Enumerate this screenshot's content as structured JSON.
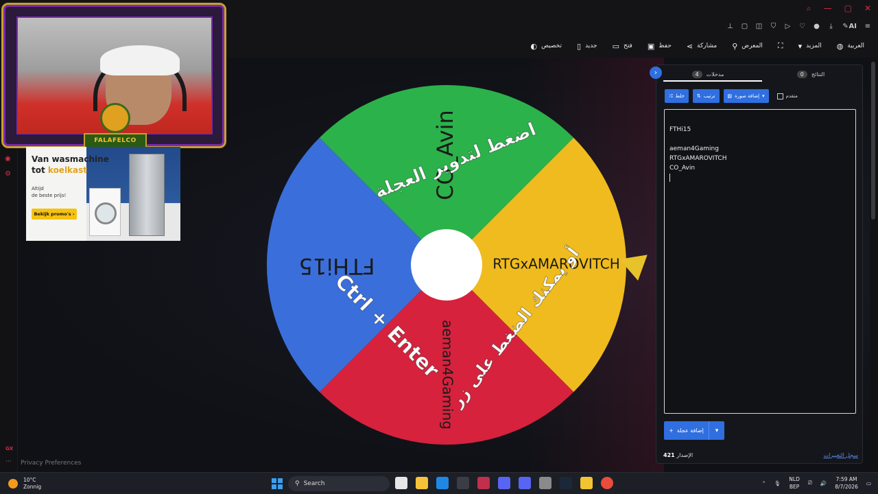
{
  "browser": {
    "window_controls": [
      "⌕",
      "—",
      "▢",
      "✕"
    ],
    "extension_icons": [
      "pin-icon",
      "screenshot-icon",
      "camera-icon",
      "shield-icon",
      "play-icon",
      "heart-icon",
      "profile-icon",
      "download-icon",
      "ai-icon",
      "menu-icon"
    ],
    "ai_label": "AI"
  },
  "toolbar": {
    "items": [
      {
        "label": "العربية",
        "icon": "globe-icon",
        "glyph": "◍"
      },
      {
        "label": "المزيد",
        "icon": "chevron-down-icon",
        "glyph": "▾"
      },
      {
        "label": "",
        "icon": "fullscreen-icon",
        "glyph": "⛶"
      },
      {
        "label": "المعرض",
        "icon": "search-icon",
        "glyph": "⚲"
      },
      {
        "label": "مشاركة",
        "icon": "share-icon",
        "glyph": "⋖"
      },
      {
        "label": "حفظ",
        "icon": "save-icon",
        "glyph": "▣"
      },
      {
        "label": "فتح",
        "icon": "folder-icon",
        "glyph": "▭"
      },
      {
        "label": "جديد",
        "icon": "file-icon",
        "glyph": "▯"
      },
      {
        "label": "تخصيص",
        "icon": "palette-icon",
        "glyph": "◐"
      }
    ]
  },
  "wheel": {
    "center_color": "#ffffff",
    "segments": [
      {
        "label": "CO_Avin",
        "color": "#2bb24a"
      },
      {
        "label": "RTGxAMAROVITCH",
        "color": "#efbb1e"
      },
      {
        "label": "aeman4Gaming",
        "color": "#d6223d"
      },
      {
        "label": "FTHi15",
        "color": "#3a6fdb"
      }
    ],
    "overlay_line1": "اضغط لتدوير العجلة",
    "overlay_line2": "أو يمكنك الضغط على زر",
    "overlay_line3": "Ctrl + Enter",
    "pointer_color": "#e8c22a"
  },
  "panel": {
    "tabs": [
      {
        "label": "مدخلات",
        "count": "4"
      },
      {
        "label": "النتائج",
        "count": "0"
      }
    ],
    "controls": {
      "shuffle": "خلط",
      "sort": "ترتيب",
      "add_image": "إضافة صورة",
      "advanced": "متقدم"
    },
    "entries": [
      "FTHi15",
      "",
      "aeman4Gaming",
      "RTGxAMAROVITCH",
      "CO_Avin"
    ],
    "add_wheel": "إضافة عجلة",
    "changelog": "سجل التغييرات",
    "version_label": "الإصدار",
    "version_number": "421"
  },
  "overlay": {
    "badge_text": "FALAFELCO",
    "ad": {
      "title_1": "Van wasmachine",
      "title_2a": "tot ",
      "title_2b": "koelkast",
      "sub_1": "Altijd",
      "sub_2": "de beste prijs!",
      "button": "Bekijk promo's ›"
    },
    "privacy": "Privacy Preferences",
    "gx": "GX",
    "dots": "···"
  },
  "taskbar": {
    "temperature": "10°C",
    "weather": "Zonnig",
    "search": "Search",
    "lang_1": "NLD",
    "lang_2": "BEP",
    "time": "7:59 AM",
    "date": "8/7/2026",
    "app_colors": [
      "#e6e6e6",
      "#f5c23a",
      "#1e88e5",
      "#3a3d45",
      "#c0304a",
      "#5865f2",
      "#5865f2",
      "#8a8a8a",
      "#1b2838",
      "#f2c431",
      "#e74c3c"
    ]
  }
}
